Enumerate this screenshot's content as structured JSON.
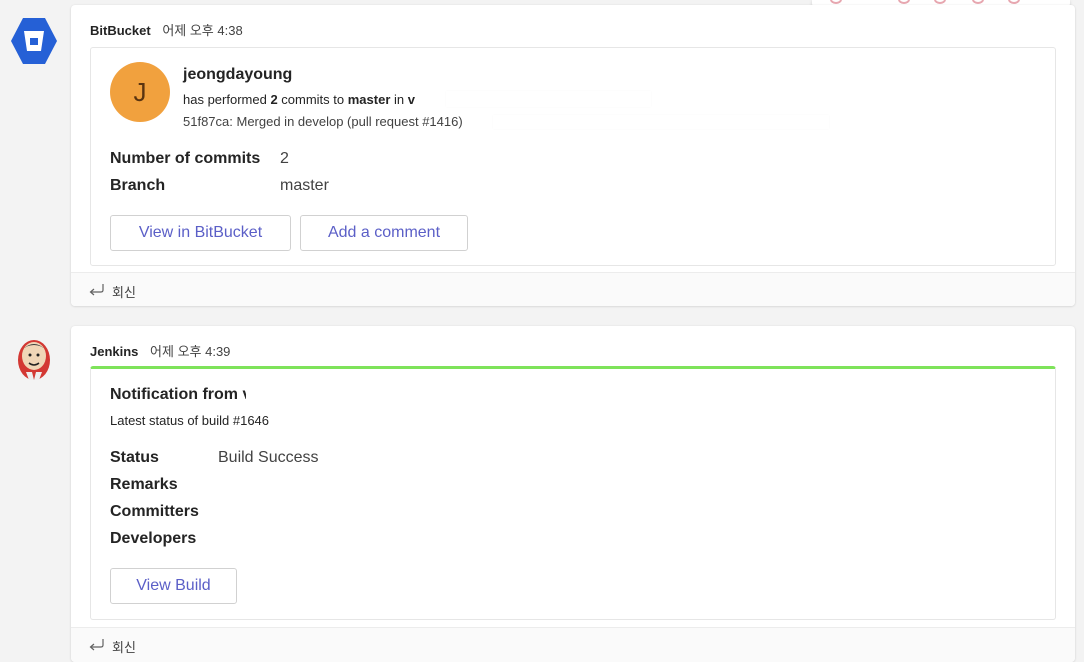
{
  "messages": [
    {
      "sender": "BitBucket",
      "time": "어제 오후 4:38",
      "card": {
        "avatar_initial": "J",
        "user": "jeongdayoung",
        "action_prefix": "has performed ",
        "commit_count": "2",
        "action_middle": " commits to ",
        "branch_ref": "master",
        "action_suffix": " in ",
        "repo_fragment": "v",
        "commit_line": "51f87ca: Merged in develop (pull request #1416)",
        "facts": [
          {
            "label": "Number of commits",
            "value": "2"
          },
          {
            "label": "Branch",
            "value": "master"
          }
        ],
        "buttons": [
          "View in BitBucket",
          "Add a comment"
        ]
      },
      "reply_label": "회신"
    },
    {
      "sender": "Jenkins",
      "time": "어제 오후 4:39",
      "card": {
        "accent_color": "#7ee35a",
        "title": "Notification from",
        "title_fragment": "v",
        "subtitle": "Latest status of build #1646",
        "facts": [
          {
            "label": "Status",
            "value": "Build Success"
          },
          {
            "label": "Remarks",
            "value": ""
          },
          {
            "label": "Committers",
            "value": ""
          },
          {
            "label": "Developers",
            "value": ""
          }
        ],
        "buttons": [
          "View Build"
        ]
      },
      "reply_label": "회신"
    }
  ],
  "icons": {
    "bitbucket": "bitbucket-logo-icon",
    "jenkins": "jenkins-logo-icon",
    "reply": "reply-arrow-icon"
  },
  "colors": {
    "bitbucket_blue": "#2560d6",
    "avatar_orange": "#f1a13e",
    "button_text": "#5b5fc7",
    "success_accent": "#7ee35a"
  }
}
